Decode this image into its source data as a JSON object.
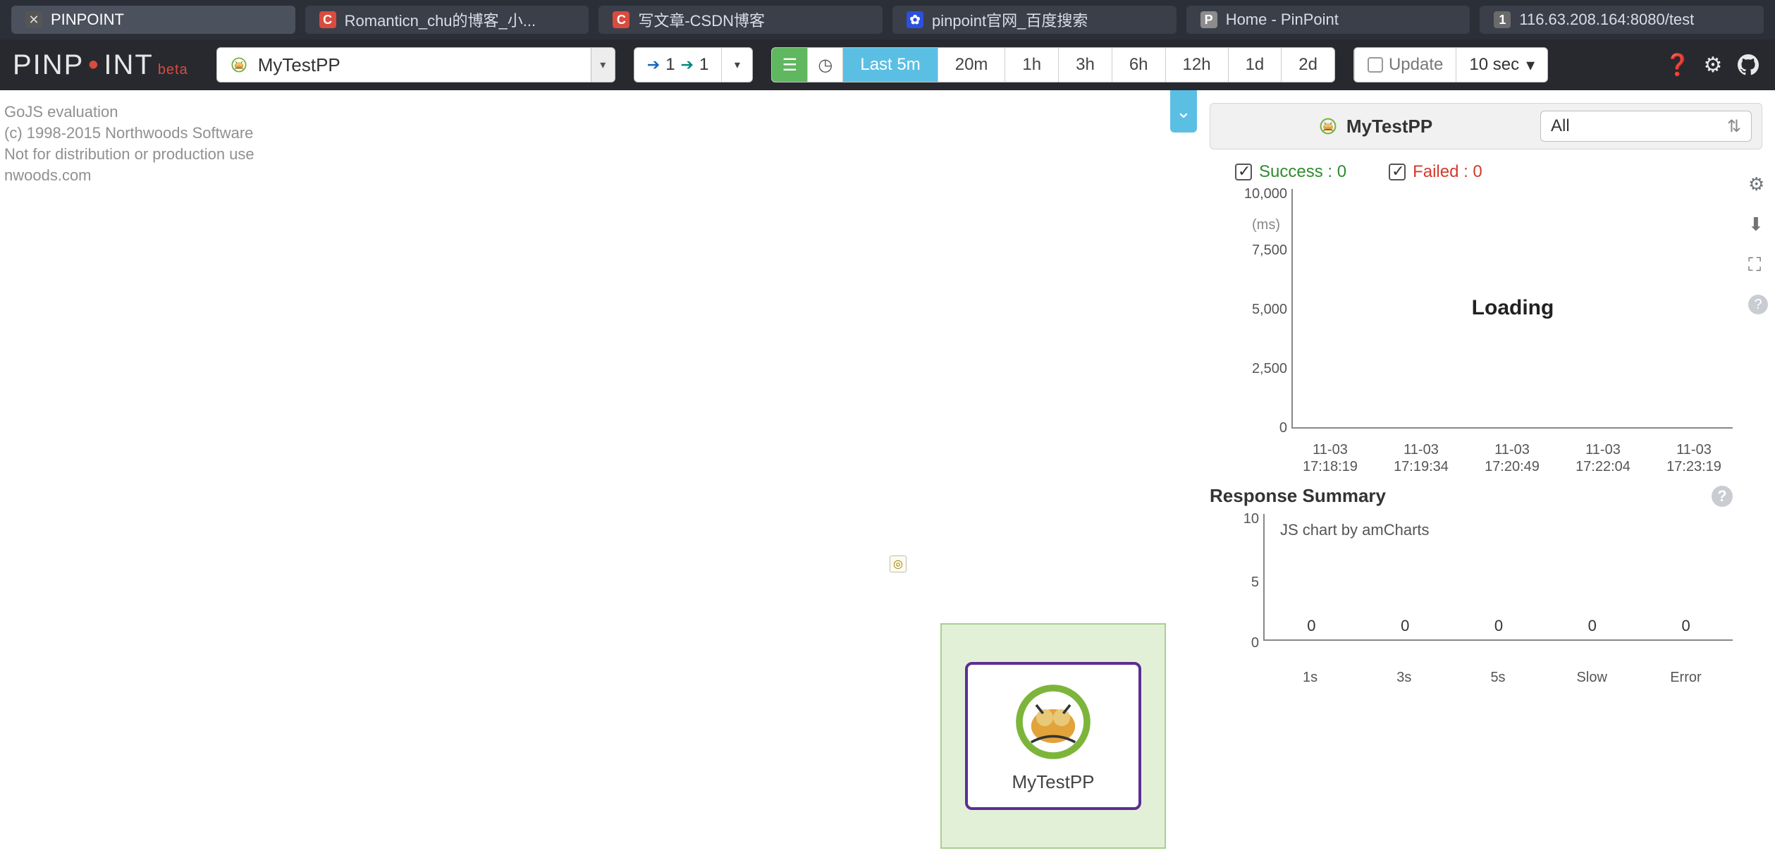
{
  "tabs": [
    {
      "label": "PINPOINT",
      "active": true,
      "fav": "pin"
    },
    {
      "label": "Romanticn_chu的博客_小...",
      "fav": "c"
    },
    {
      "label": "写文章-CSDN博客",
      "fav": "c"
    },
    {
      "label": "pinpoint官网_百度搜索",
      "fav": "baidu"
    },
    {
      "label": "Home - PinPoint",
      "fav": "p"
    },
    {
      "label": "116.63.208.164:8080/test",
      "fav": "1"
    }
  ],
  "logo": {
    "text": "PINP",
    "text2": "INT",
    "beta": "beta"
  },
  "app_select": {
    "value": "MyTestPP"
  },
  "depth": {
    "in": "1",
    "out": "1"
  },
  "ranges": [
    "Last 5m",
    "20m",
    "1h",
    "3h",
    "6h",
    "12h",
    "1d",
    "2d"
  ],
  "active_range_index": 0,
  "update_label": "Update",
  "refresh_sec": "10 sec",
  "gojs": {
    "l1": "GoJS evaluation",
    "l2": "(c) 1998-2015 Northwoods Software",
    "l3": "Not for distribution or production use",
    "l4": "nwoods.com"
  },
  "node": {
    "label": "MyTestPP"
  },
  "right": {
    "title": "MyTestPP",
    "filter": "All",
    "success": "Success : 0",
    "failed": "Failed : 0",
    "loading": "Loading",
    "resp_summary": "Response Summary",
    "am_credit": "JS chart by amCharts"
  },
  "chart_data": [
    {
      "type": "line",
      "title": "",
      "ylabel": "(ms)",
      "ylim": [
        0,
        10000
      ],
      "y_ticks": [
        0,
        2500,
        5000,
        7500,
        10000
      ],
      "x_ticks": [
        "11-03\n17:18:19",
        "11-03\n17:19:34",
        "11-03\n17:20:49",
        "11-03\n17:22:04",
        "11-03\n17:23:19"
      ],
      "series": [
        {
          "name": "Success",
          "values": []
        },
        {
          "name": "Failed",
          "values": []
        }
      ],
      "state": "loading"
    },
    {
      "type": "bar",
      "title": "Response Summary",
      "ylim": [
        0,
        10
      ],
      "y_ticks": [
        0,
        5,
        10
      ],
      "categories": [
        "1s",
        "3s",
        "5s",
        "Slow",
        "Error"
      ],
      "values": [
        0,
        0,
        0,
        0,
        0
      ]
    }
  ]
}
